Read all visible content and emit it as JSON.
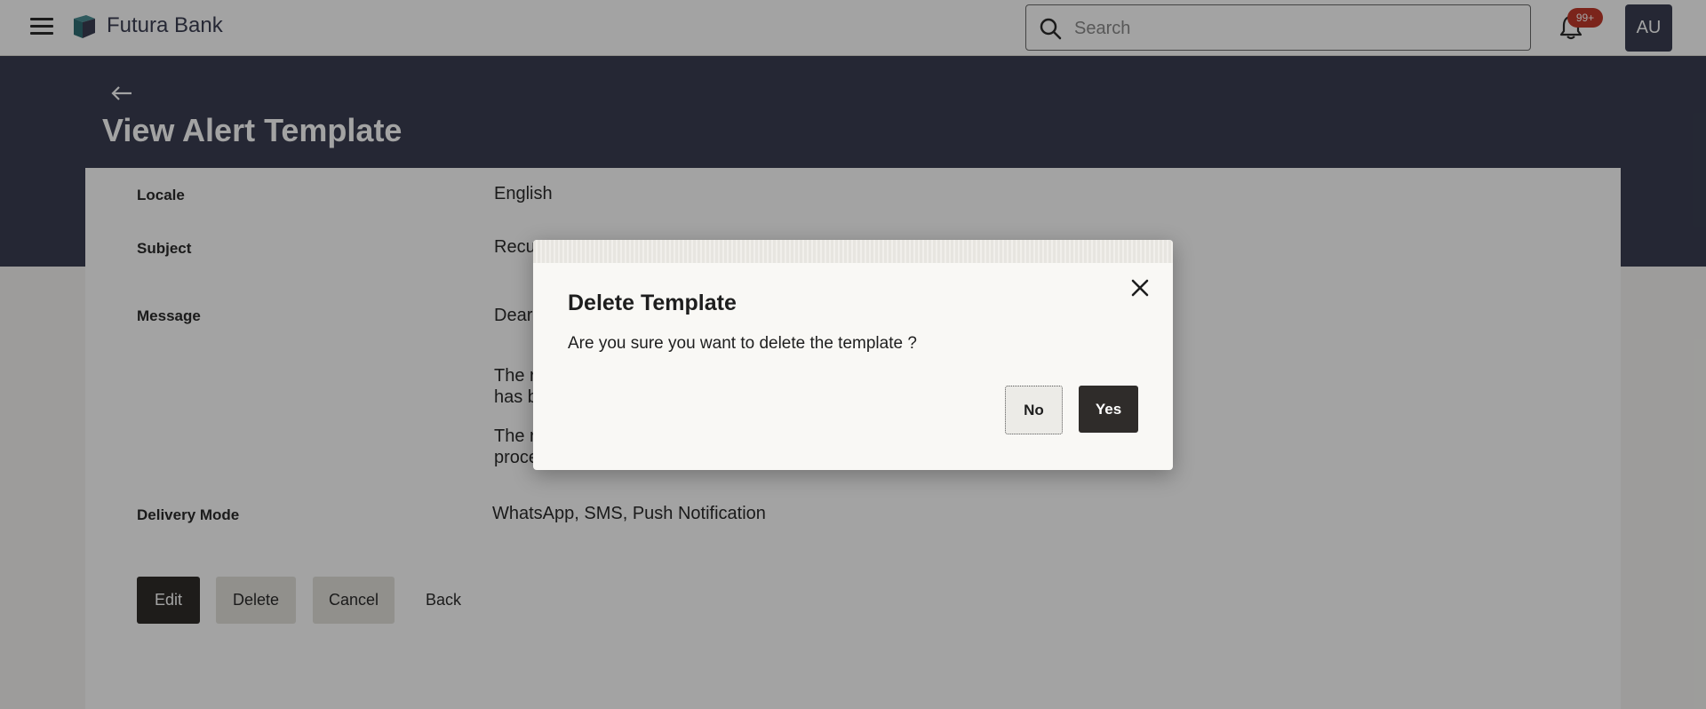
{
  "header": {
    "brand": "Futura Bank",
    "search_placeholder": "Search",
    "notification_count": "99+",
    "avatar_initials": "AU"
  },
  "page": {
    "title": "View Alert Template"
  },
  "details": {
    "locale_label": "Locale",
    "locale_value": "English",
    "subject_label": "Subject",
    "subject_value": "Recu",
    "message_label": "Message",
    "message_line1": "Dear",
    "message_line2": "The r",
    "message_line3": "has b",
    "message_line4": "The r",
    "message_line5": "proce",
    "delivery_label": "Delivery Mode",
    "delivery_value": "WhatsApp, SMS, Push Notification"
  },
  "actions": {
    "edit": "Edit",
    "delete": "Delete",
    "cancel": "Cancel",
    "back": "Back"
  },
  "modal": {
    "title": "Delete Template",
    "text": "Are you sure you want to delete the template ?",
    "no": "No",
    "yes": "Yes"
  },
  "colors": {
    "brand_dark": "#3a3e52",
    "primary_button": "#2f2c2a",
    "badge": "#c0392b"
  }
}
